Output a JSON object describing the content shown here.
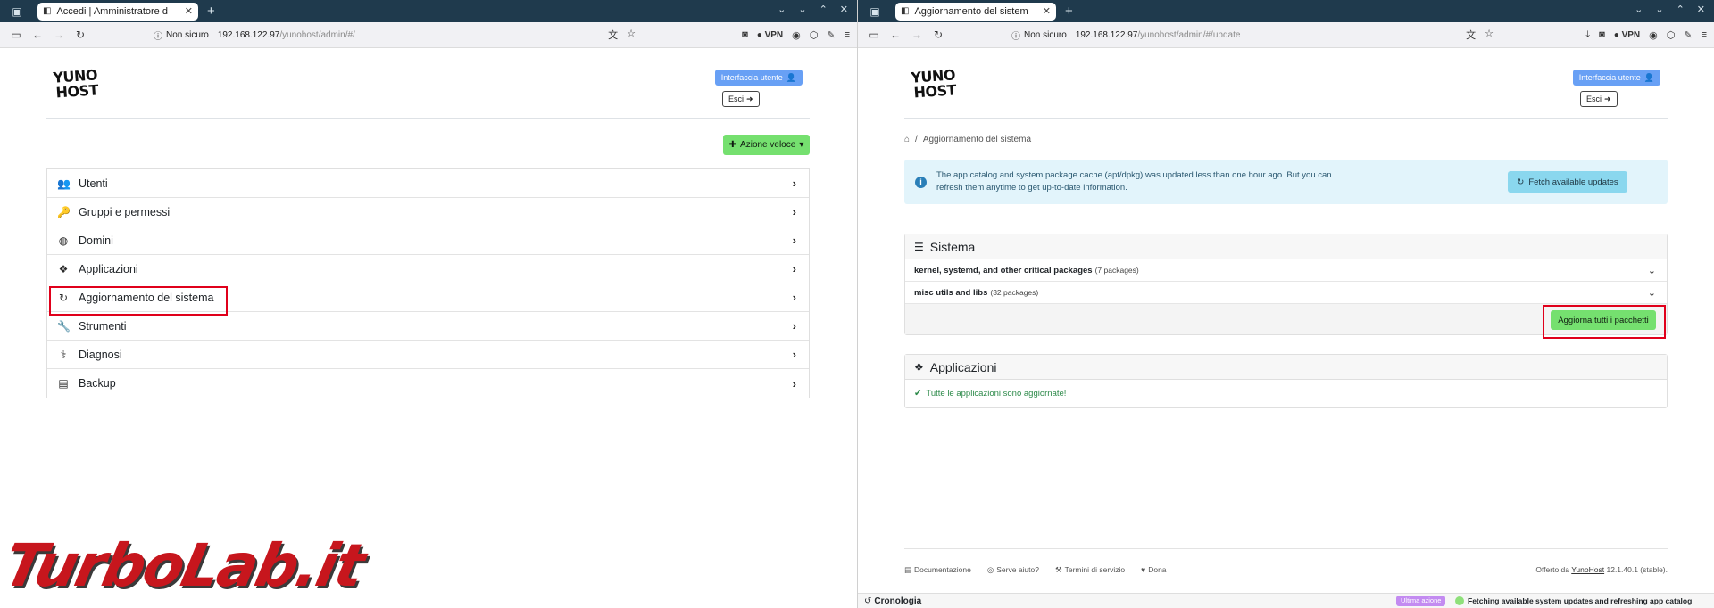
{
  "left": {
    "tab": {
      "title": "Accedi | Amministratore d"
    },
    "url": {
      "security": "Non sicuro",
      "host": "192.168.122.97",
      "path": "/yunohost/admin/#/"
    },
    "logo": [
      "YUNO",
      "HOST"
    ],
    "header": {
      "user_button": "Interfaccia utente",
      "logout_button": "Esci"
    },
    "quick_action": "Azione veloce",
    "menu": [
      {
        "label": "Utenti",
        "icon": "users-icon"
      },
      {
        "label": "Gruppi e permessi",
        "icon": "key-icon"
      },
      {
        "label": "Domini",
        "icon": "globe-icon"
      },
      {
        "label": "Applicazioni",
        "icon": "cubes-icon"
      },
      {
        "label": "Aggiornamento del sistema",
        "icon": "refresh-icon",
        "highlighted": true
      },
      {
        "label": "Strumenti",
        "icon": "wrench-icon"
      },
      {
        "label": "Diagnosi",
        "icon": "stethoscope-icon"
      },
      {
        "label": "Backup",
        "icon": "archive-icon"
      }
    ]
  },
  "right": {
    "tab": {
      "title": "Aggiornamento del sistem"
    },
    "url": {
      "security": "Non sicuro",
      "host": "192.168.122.97",
      "path": "/yunohost/admin/#/update"
    },
    "breadcrumb": {
      "current": "Aggiornamento del sistema"
    },
    "alert": {
      "text": "The app catalog and system package cache (apt/dpkg) was updated less than one hour ago. But you can refresh them anytime to get up-to-date information.",
      "button": "Fetch available updates"
    },
    "system_card": {
      "title": "Sistema",
      "packages": [
        {
          "name": "kernel, systemd, and other critical packages",
          "count": "(7 packages)"
        },
        {
          "name": "misc utils and libs",
          "count": "(32 packages)"
        }
      ],
      "upgrade_button": "Aggiorna tutti i pacchetti"
    },
    "apps_card": {
      "title": "Applicazioni",
      "status": "Tutte le applicazioni sono aggiornate!"
    },
    "footer": {
      "links": [
        "Documentazione",
        "Serve aiuto?",
        "Termini di servizio",
        "Dona"
      ],
      "credit_prefix": "Offerto da",
      "credit_link": "YunoHost",
      "credit_version": "12.1.40.1 (stable)."
    },
    "history": {
      "title": "Cronologia",
      "badge": "Ultima azione",
      "message": "Fetching available system updates and refreshing app catalog"
    }
  },
  "browser": {
    "vpn_label": "VPN"
  },
  "watermark": "TurboLab.it",
  "colors": {
    "accent_green": "#75e06f",
    "primary_blue": "#68a0f5",
    "highlight_red": "#e0001b",
    "tabbar": "#1f3a4d"
  }
}
